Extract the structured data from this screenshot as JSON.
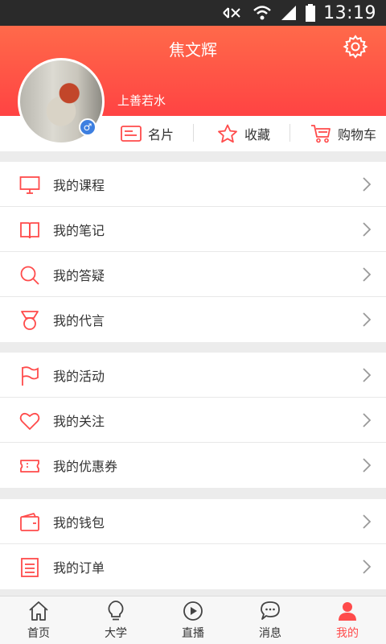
{
  "status_bar": {
    "time": "13:19"
  },
  "header": {
    "title": "焦文辉",
    "bio": "上善若水"
  },
  "quick_actions": [
    {
      "label": "名片",
      "icon": "card-icon"
    },
    {
      "label": "收藏",
      "icon": "star-icon"
    },
    {
      "label": "购物车",
      "icon": "cart-icon"
    }
  ],
  "menu_groups": [
    [
      {
        "label": "我的课程",
        "icon": "monitor-icon"
      },
      {
        "label": "我的笔记",
        "icon": "book-icon"
      },
      {
        "label": "我的答疑",
        "icon": "search-icon"
      },
      {
        "label": "我的代言",
        "icon": "medal-icon"
      }
    ],
    [
      {
        "label": "我的活动",
        "icon": "flag-icon"
      },
      {
        "label": "我的关注",
        "icon": "heart-icon"
      },
      {
        "label": "我的优惠券",
        "icon": "ticket-icon"
      }
    ],
    [
      {
        "label": "我的钱包",
        "icon": "wallet-icon"
      },
      {
        "label": "我的订单",
        "icon": "order-icon"
      }
    ]
  ],
  "tabbar": [
    {
      "label": "首页",
      "icon": "home-icon"
    },
    {
      "label": "大学",
      "icon": "bulb-icon"
    },
    {
      "label": "直播",
      "icon": "play-icon"
    },
    {
      "label": "消息",
      "icon": "chat-icon"
    },
    {
      "label": "我的",
      "icon": "user-icon",
      "active": true
    }
  ],
  "colors": {
    "accent": "#ff4b4b",
    "header_top": "#ff6a4a",
    "header_bottom": "#ff4343",
    "gender_badge": "#3d7fe0"
  }
}
